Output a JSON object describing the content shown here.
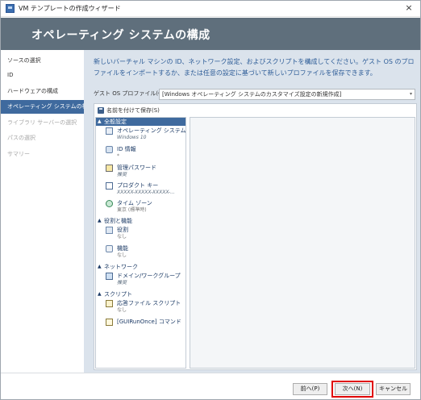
{
  "window": {
    "title": "VM テンプレートの作成ウィザード",
    "close_glyph": "×"
  },
  "header": {
    "title": "オペレーティング システムの構成"
  },
  "nav": {
    "items": [
      {
        "label": "ソースの選択",
        "state": "normal"
      },
      {
        "label": "ID",
        "state": "normal"
      },
      {
        "label": "ハードウェアの構成",
        "state": "normal"
      },
      {
        "label": "オペレーティング システムの構成",
        "state": "active"
      },
      {
        "label": "ライブラリ サーバーの選択",
        "state": "disabled"
      },
      {
        "label": "パスの選択",
        "state": "disabled"
      },
      {
        "label": "サマリー",
        "state": "disabled"
      }
    ]
  },
  "main": {
    "description": "新しいバーチャル マシンの ID、ネットワーク設定、およびスクリプトを構成してください。ゲスト OS のプロファイルをインポートするか、または任意の設定に基づいて新しいプロファイルを保存できます。",
    "guest_profile_label": "ゲスト OS プロファイル(G):",
    "guest_profile_value": "[Windows オペレーティング システムのカスタマイズ設定の新規作成]",
    "dropdown_glyph": "▾",
    "save_as_label": "名前を付けて保存(S)"
  },
  "tree": {
    "collapse_glyph": "▲",
    "groups": {
      "general": "全般設定",
      "roles": "役割と機能",
      "network": "ネットワーク",
      "scripts": "スクリプト"
    },
    "items": {
      "os": {
        "label": "オペレーティング システム",
        "sub": "Windows 10"
      },
      "id": {
        "label": "ID 情報",
        "sub": "*"
      },
      "admin": {
        "label": "管理パスワード",
        "sub": "推奨"
      },
      "product_key": {
        "label": "プロダクト キー",
        "sub": "XXXXX-XXXXX-XXXXX-..."
      },
      "timezone": {
        "label": "タイム ゾーン",
        "sub": "東京 (標準時)"
      },
      "role": {
        "label": "役割",
        "sub": "なし"
      },
      "feature": {
        "label": "機能",
        "sub": "なし"
      },
      "domain": {
        "label": "ドメイン/ワークグループ",
        "sub": "推奨"
      },
      "answer_file": {
        "label": "応答ファイル スクリプト",
        "sub": "なし"
      },
      "guirunonce": {
        "label": "[GUIRunOnce] コマンド",
        "sub": ""
      }
    }
  },
  "footer": {
    "prev_label": "前へ(P)",
    "next_label": "次へ(N)",
    "cancel_label": "キャンセル"
  },
  "colors": {
    "header_band": "#5f6f7c",
    "active_nav": "#3f6a9e",
    "main_bg": "#dbe3ec",
    "description_text": "#2e5d98",
    "highlight_box": "#e00000"
  }
}
